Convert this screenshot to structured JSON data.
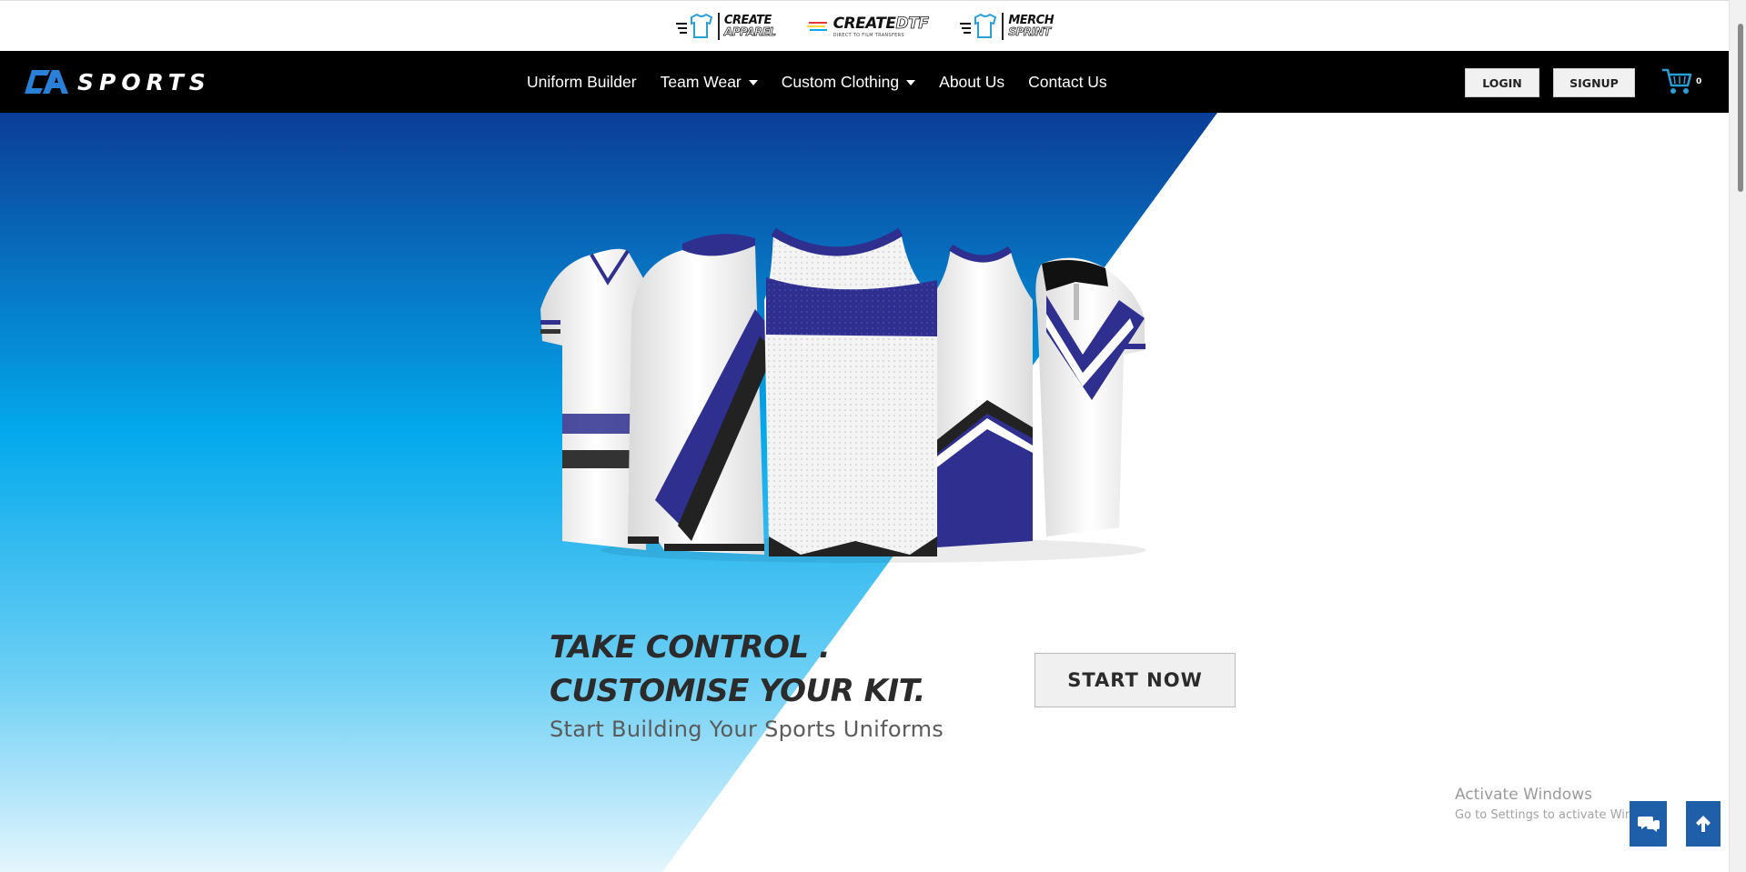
{
  "brands": [
    {
      "line1": "CREATE",
      "line2": "APPAREL"
    },
    {
      "word1": "CREATE",
      "word2": "DTF",
      "tagline": "DIRECT TO FILM TRANSFERS"
    },
    {
      "line1": "MERCH",
      "line2": "SPRINT"
    }
  ],
  "site": {
    "logo_text": "SPORTS"
  },
  "nav": {
    "links": [
      {
        "label": "Uniform Builder"
      },
      {
        "label": "Team Wear"
      },
      {
        "label": "Custom Clothing"
      },
      {
        "label": "About Us"
      },
      {
        "label": "Contact Us"
      }
    ],
    "login_label": "LOGIN",
    "signup_label": "SIGNUP",
    "cart_count": "0"
  },
  "hero": {
    "headline_line1": "TAKE CONTROL .",
    "headline_line2": "CUSTOMISE YOUR KIT.",
    "subheadline": "Start Building Your Sports Uniforms",
    "cta_label": "START NOW"
  },
  "windows_watermark": {
    "title": "Activate Windows",
    "subtitle": "Go to Settings to activate Windows."
  },
  "icons": {
    "cart": "cart-icon",
    "chat": "chat-icon",
    "scroll_top": "arrow-up-icon"
  },
  "colors": {
    "nav_bg": "#000000",
    "hero_blue_dark": "#0b3d97",
    "hero_blue_mid": "#03a9ec",
    "jersey_navy": "#2e2f8f",
    "cart_blue": "#2a9fd6",
    "float_button": "#1f5ea8"
  }
}
